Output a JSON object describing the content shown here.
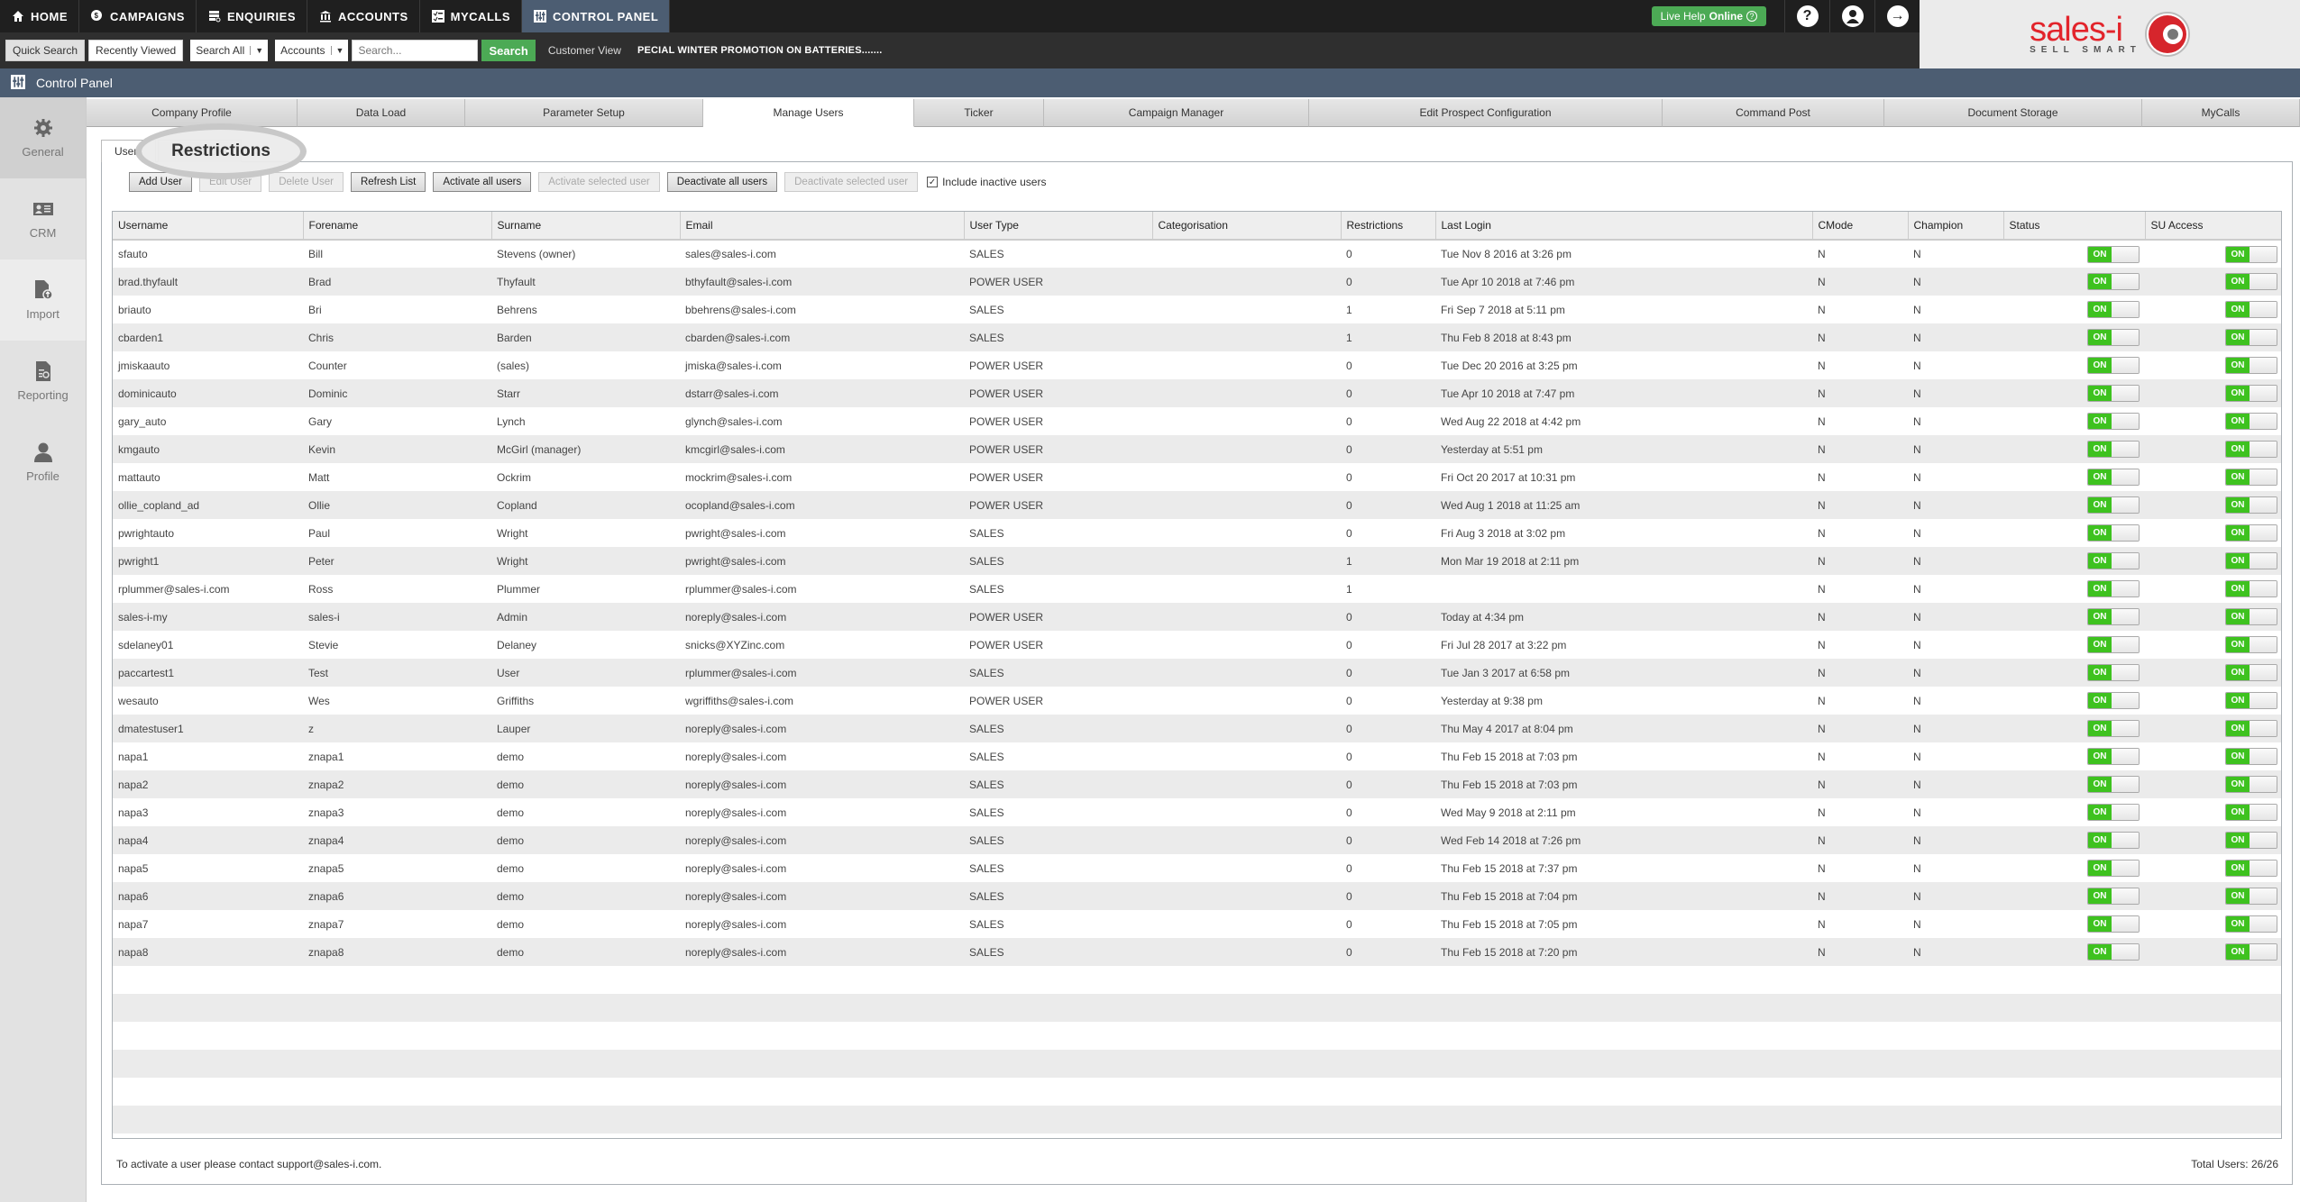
{
  "nav": {
    "items": [
      {
        "label": "HOME",
        "icon": "home-icon"
      },
      {
        "label": "CAMPAIGNS",
        "icon": "campaigns-icon"
      },
      {
        "label": "ENQUIRIES",
        "icon": "enquiries-icon"
      },
      {
        "label": "ACCOUNTS",
        "icon": "accounts-icon"
      },
      {
        "label": "MYCALLS",
        "icon": "mycalls-icon"
      },
      {
        "label": "CONTROL PANEL",
        "icon": "control-panel-icon",
        "active": true
      }
    ],
    "live_help": "Live Help",
    "live_help_status": "Online",
    "help_icon": "?",
    "logout_icon": "→"
  },
  "searchbar": {
    "quick_search": "Quick Search",
    "recently_viewed": "Recently Viewed",
    "scope_select": "Search All",
    "type_select": "Accounts",
    "search_placeholder": "Search...",
    "search_button": "Search",
    "customer_view": "Customer View",
    "ticker": "PECIAL WINTER PROMOTION ON BATTERIES......."
  },
  "logo": {
    "main": "sales-i",
    "sub": "SELL SMART"
  },
  "panel_header": {
    "title": "Control Panel"
  },
  "sidebar": {
    "items": [
      {
        "label": "General",
        "icon": "gear-icon"
      },
      {
        "label": "CRM",
        "icon": "contact-card-icon"
      },
      {
        "label": "Import",
        "icon": "import-file-icon"
      },
      {
        "label": "Reporting",
        "icon": "report-icon"
      },
      {
        "label": "Profile",
        "icon": "user-icon"
      }
    ]
  },
  "tabs": [
    "Company Profile",
    "Data Load",
    "Parameter Setup",
    "Manage Users",
    "Ticker",
    "Campaign Manager",
    "Edit Prospect Configuration",
    "Command Post",
    "Document Storage",
    "MyCalls"
  ],
  "subtabs": {
    "users": "Users",
    "restrictions": "Restrictions",
    "magnifier": "Restrictions"
  },
  "toolbar": {
    "add_user": "Add User",
    "edit_user": "Edit User",
    "delete_user": "Delete User",
    "refresh_list": "Refresh List",
    "activate_all": "Activate all users",
    "activate_selected": "Activate selected user",
    "deactivate_all": "Deactivate all users",
    "deactivate_selected": "Deactivate selected user",
    "include_inactive": "Include inactive users",
    "include_inactive_checked": true
  },
  "table": {
    "columns": [
      "Username",
      "Forename",
      "Surname",
      "Email",
      "User Type",
      "Categorisation",
      "Restrictions",
      "Last Login",
      "CMode",
      "Champion",
      "Status",
      "SU Access"
    ],
    "toggle_on_label": "ON",
    "rows": [
      [
        "sfauto",
        "Bill",
        "Stevens (owner)",
        "sales@sales-i.com",
        "SALES",
        "",
        "0",
        "Tue Nov 8 2016 at 3:26 pm",
        "N",
        "N",
        "ON",
        "ON"
      ],
      [
        "brad.thyfault",
        "Brad",
        "Thyfault",
        "bthyfault@sales-i.com",
        "POWER USER",
        "",
        "0",
        "Tue Apr 10 2018 at 7:46 pm",
        "N",
        "N",
        "ON",
        "ON"
      ],
      [
        "briauto",
        "Bri",
        "Behrens",
        "bbehrens@sales-i.com",
        "SALES",
        "",
        "1",
        "Fri Sep 7 2018 at 5:11 pm",
        "N",
        "N",
        "ON",
        "ON"
      ],
      [
        "cbarden1",
        "Chris",
        "Barden",
        "cbarden@sales-i.com",
        "SALES",
        "",
        "1",
        "Thu Feb 8 2018 at 8:43 pm",
        "N",
        "N",
        "ON",
        "ON"
      ],
      [
        "jmiskaauto",
        "Counter",
        "(sales)",
        "jmiska@sales-i.com",
        "POWER USER",
        "",
        "0",
        "Tue Dec 20 2016 at 3:25 pm",
        "N",
        "N",
        "ON",
        "ON"
      ],
      [
        "dominicauto",
        "Dominic",
        "Starr",
        "dstarr@sales-i.com",
        "POWER USER",
        "",
        "0",
        "Tue Apr 10 2018 at 7:47 pm",
        "N",
        "N",
        "ON",
        "ON"
      ],
      [
        "gary_auto",
        "Gary",
        "Lynch",
        "glynch@sales-i.com",
        "POWER USER",
        "",
        "0",
        "Wed Aug 22 2018 at 4:42 pm",
        "N",
        "N",
        "ON",
        "ON"
      ],
      [
        "kmgauto",
        "Kevin",
        "McGirl (manager)",
        "kmcgirl@sales-i.com",
        "POWER USER",
        "",
        "0",
        "Yesterday at 5:51 pm",
        "N",
        "N",
        "ON",
        "ON"
      ],
      [
        "mattauto",
        "Matt",
        "Ockrim",
        "mockrim@sales-i.com",
        "POWER USER",
        "",
        "0",
        "Fri Oct 20 2017 at 10:31 pm",
        "N",
        "N",
        "ON",
        "ON"
      ],
      [
        "ollie_copland_ad",
        "Ollie",
        "Copland",
        "ocopland@sales-i.com",
        "POWER USER",
        "",
        "0",
        "Wed Aug 1 2018 at 11:25 am",
        "N",
        "N",
        "ON",
        "ON"
      ],
      [
        "pwrightauto",
        "Paul",
        "Wright",
        "pwright@sales-i.com",
        "SALES",
        "",
        "0",
        "Fri Aug 3 2018 at 3:02 pm",
        "N",
        "N",
        "ON",
        "ON"
      ],
      [
        "pwright1",
        "Peter",
        "Wright",
        "pwright@sales-i.com",
        "SALES",
        "",
        "1",
        "Mon Mar 19 2018 at 2:11 pm",
        "N",
        "N",
        "ON",
        "ON"
      ],
      [
        "rplummer@sales-i.com",
        "Ross",
        "Plummer",
        "rplummer@sales-i.com",
        "SALES",
        "",
        "1",
        "",
        "N",
        "N",
        "ON",
        "ON"
      ],
      [
        "sales-i-my",
        "sales-i",
        "Admin",
        "noreply@sales-i.com",
        "POWER USER",
        "",
        "0",
        "Today at 4:34 pm",
        "N",
        "N",
        "ON",
        "ON"
      ],
      [
        "sdelaney01",
        "Stevie",
        "Delaney",
        "snicks@XYZinc.com",
        "POWER USER",
        "",
        "0",
        "Fri Jul 28 2017 at 3:22 pm",
        "N",
        "N",
        "ON",
        "ON"
      ],
      [
        "paccartest1",
        "Test",
        "User",
        "rplummer@sales-i.com",
        "SALES",
        "",
        "0",
        "Tue Jan 3 2017 at 6:58 pm",
        "N",
        "N",
        "ON",
        "ON"
      ],
      [
        "wesauto",
        "Wes",
        "Griffiths",
        "wgriffiths@sales-i.com",
        "POWER USER",
        "",
        "0",
        "Yesterday at 9:38 pm",
        "N",
        "N",
        "ON",
        "ON"
      ],
      [
        "dmatestuser1",
        "z",
        "Lauper",
        "noreply@sales-i.com",
        "SALES",
        "",
        "0",
        "Thu May 4 2017 at 8:04 pm",
        "N",
        "N",
        "ON",
        "ON"
      ],
      [
        "napa1",
        "znapa1",
        "demo",
        "noreply@sales-i.com",
        "SALES",
        "",
        "0",
        "Thu Feb 15 2018 at 7:03 pm",
        "N",
        "N",
        "ON",
        "ON"
      ],
      [
        "napa2",
        "znapa2",
        "demo",
        "noreply@sales-i.com",
        "SALES",
        "",
        "0",
        "Thu Feb 15 2018 at 7:03 pm",
        "N",
        "N",
        "ON",
        "ON"
      ],
      [
        "napa3",
        "znapa3",
        "demo",
        "noreply@sales-i.com",
        "SALES",
        "",
        "0",
        "Wed May 9 2018 at 2:11 pm",
        "N",
        "N",
        "ON",
        "ON"
      ],
      [
        "napa4",
        "znapa4",
        "demo",
        "noreply@sales-i.com",
        "SALES",
        "",
        "0",
        "Wed Feb 14 2018 at 7:26 pm",
        "N",
        "N",
        "ON",
        "ON"
      ],
      [
        "napa5",
        "znapa5",
        "demo",
        "noreply@sales-i.com",
        "SALES",
        "",
        "0",
        "Thu Feb 15 2018 at 7:37 pm",
        "N",
        "N",
        "ON",
        "ON"
      ],
      [
        "napa6",
        "znapa6",
        "demo",
        "noreply@sales-i.com",
        "SALES",
        "",
        "0",
        "Thu Feb 15 2018 at 7:04 pm",
        "N",
        "N",
        "ON",
        "ON"
      ],
      [
        "napa7",
        "znapa7",
        "demo",
        "noreply@sales-i.com",
        "SALES",
        "",
        "0",
        "Thu Feb 15 2018 at 7:05 pm",
        "N",
        "N",
        "ON",
        "ON"
      ],
      [
        "napa8",
        "znapa8",
        "demo",
        "noreply@sales-i.com",
        "SALES",
        "",
        "0",
        "Thu Feb 15 2018 at 7:20 pm",
        "N",
        "N",
        "ON",
        "ON"
      ]
    ]
  },
  "footer": {
    "note": "To activate a user please contact support@sales-i.com.",
    "total": "Total Users: 26/26"
  },
  "colors": {
    "nav_bg": "#1f1f1f",
    "panel_header": "#4c5d72",
    "accent_green": "#4caa55",
    "toggle_on": "#3ec21f",
    "brand_red": "#e2242b"
  }
}
